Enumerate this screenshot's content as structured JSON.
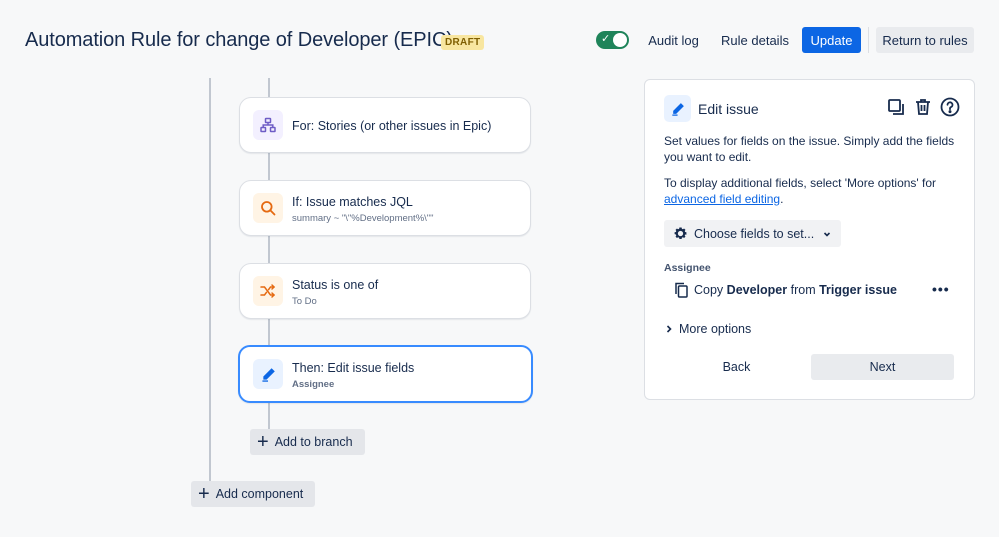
{
  "header": {
    "title": "Automation Rule for change of Developer (EPIC)",
    "badge": "DRAFT",
    "toggle_check": "✓",
    "audit_log": "Audit log",
    "rule_details": "Rule details",
    "update": "Update",
    "return_to_rules": "Return to rules"
  },
  "flow": {
    "steps": [
      {
        "title": "For: Stories (or other issues in Epic)",
        "subtitle": "",
        "icon": "hierarchy-icon",
        "color": "#6e5dc6"
      },
      {
        "title": "If: Issue matches JQL",
        "subtitle": "summary ~ \"\\\"%Development%\\\"\"",
        "icon": "search-icon",
        "color": "#e56910"
      },
      {
        "title": "Status is one of",
        "subtitle": "To Do",
        "icon": "shuffle-icon",
        "color": "#e56910"
      },
      {
        "title": "Then: Edit issue fields",
        "subtitle": "Assignee",
        "icon": "pencil-icon",
        "color": "#0c66e4"
      }
    ],
    "add_to_branch": "Add to branch",
    "add_component": "Add component"
  },
  "panel": {
    "title": "Edit issue",
    "desc1": "Set values for fields on the issue. Simply add the fields you want to edit.",
    "desc2_prefix": "To display additional fields, select 'More options' for",
    "desc2_link": "advanced field editing",
    "desc2_suffix": ".",
    "choose_fields": "Choose fields to set...",
    "assignee_label": "Assignee",
    "copy_prefix": "Copy",
    "copy_field": "Developer",
    "copy_middle": "from",
    "copy_source": "Trigger issue",
    "more_options": "More options",
    "back": "Back",
    "next": "Next"
  },
  "colors": {
    "primary": "#0c66e4",
    "toggle_on": "#1f845a",
    "selected_border": "#388bff"
  }
}
